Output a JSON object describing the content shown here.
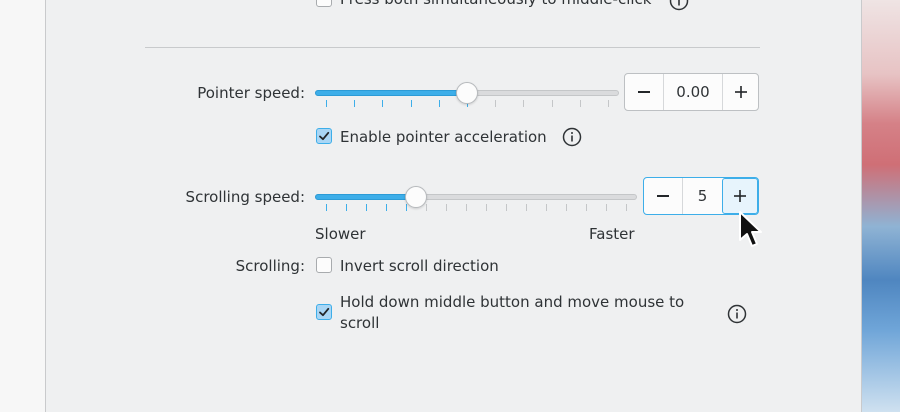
{
  "top_option": {
    "label": "Press both simultaneously to middle-click",
    "checked": false
  },
  "pointer_speed": {
    "label": "Pointer speed:",
    "value": "0.00",
    "slider_fraction": 0.5,
    "accel_label": "Enable pointer acceleration",
    "accel_checked": true
  },
  "scrolling_speed": {
    "label": "Scrolling speed:",
    "value": "5",
    "slider_fraction": 0.3,
    "slower_label": "Slower",
    "faster_label": "Faster"
  },
  "scrolling": {
    "label": "Scrolling:",
    "invert_label": "Invert scroll direction",
    "invert_checked": false,
    "middle_label_line1": "Hold down middle button and move mouse to",
    "middle_label_line2": "scroll",
    "middle_checked": true
  },
  "colors": {
    "accent": "#3daee9",
    "window_bg": "#eff0f1"
  },
  "icons": [
    "info-icon",
    "minus-icon",
    "plus-icon",
    "checkmark-icon",
    "mouse-pointer-icon"
  ]
}
